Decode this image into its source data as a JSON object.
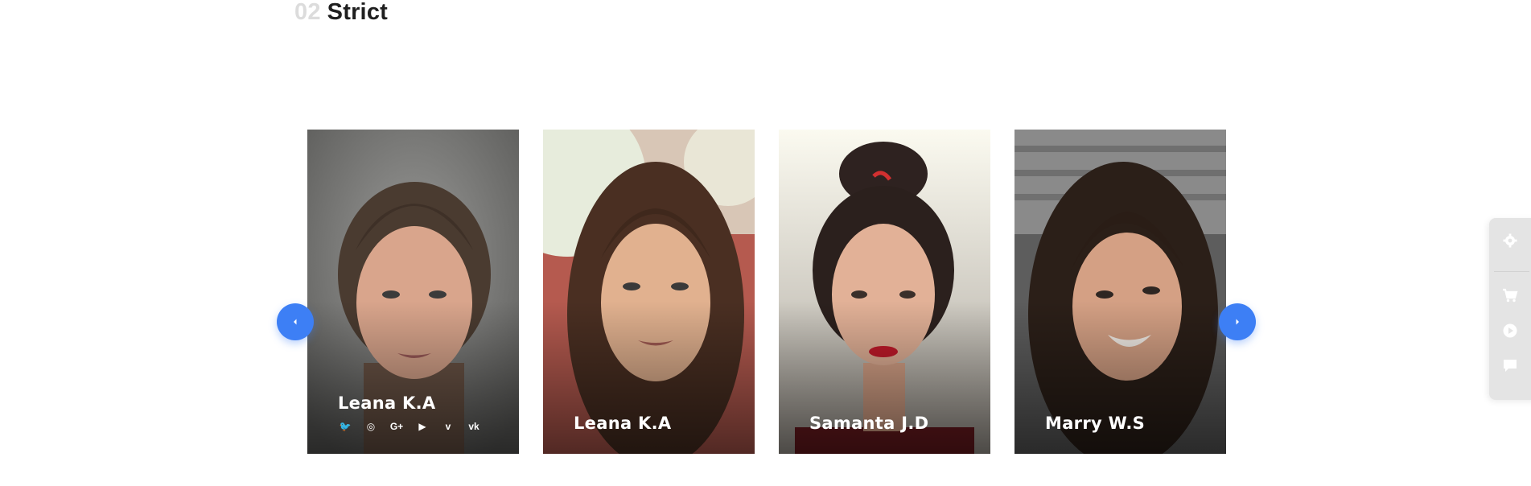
{
  "section": {
    "number": "02",
    "title": "Strict"
  },
  "team": [
    {
      "name": "Leana K.A",
      "active": true
    },
    {
      "name": "Leana K.A",
      "active": false
    },
    {
      "name": "Samanta J.D",
      "active": false
    },
    {
      "name": "Marry W.S",
      "active": false
    }
  ],
  "socials": [
    {
      "icon": "twitter-icon",
      "glyph": "🐦"
    },
    {
      "icon": "instagram-icon",
      "glyph": "◎"
    },
    {
      "icon": "google-plus-icon",
      "glyph": "G+"
    },
    {
      "icon": "youtube-icon",
      "glyph": "▶"
    },
    {
      "icon": "vimeo-icon",
      "glyph": "v"
    },
    {
      "icon": "vk-icon",
      "glyph": "vk"
    }
  ],
  "carousel": {
    "prev_icon": "chevron-left-icon",
    "next_icon": "chevron-right-icon"
  },
  "sidebar": {
    "icons": [
      "gear-icon",
      "cart-icon",
      "play-icon",
      "chat-icon"
    ]
  },
  "colors": {
    "accent": "#3d7ff5",
    "heading": "#1f1f1f",
    "heading_number": "#dcdcdc"
  }
}
